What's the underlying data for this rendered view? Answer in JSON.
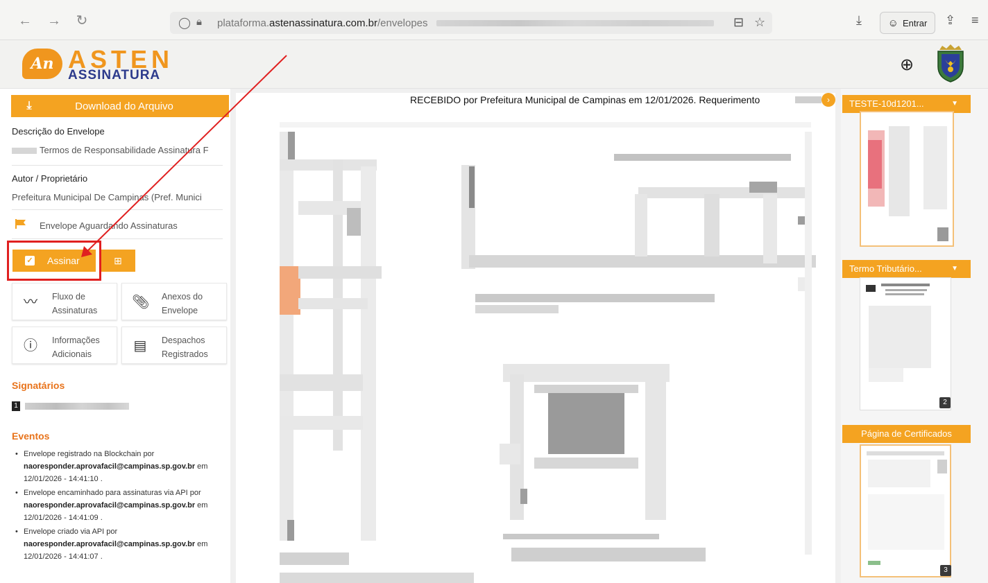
{
  "browser": {
    "url_prefix": "plataforma.",
    "url_domain": "astenassinatura.com.br",
    "url_path": "/envelopes",
    "signin_label": "Entrar"
  },
  "header": {
    "logo_top": "ASTEN",
    "logo_bottom": "ASSINATURA"
  },
  "sidebar": {
    "download_label": "Download do Arquivo",
    "description_label": "Descrição do Envelope",
    "description_value": "Termos de Responsabilidade Assinatura F",
    "author_label": "Autor / Proprietário",
    "author_value": "Prefeitura Municipal De Campinas (Pref. Munici",
    "status": "Envelope  Aguardando Assinaturas",
    "sign_label": "Assinar",
    "tiles": [
      {
        "line1": "Fluxo de",
        "line2": "Assinaturas"
      },
      {
        "line1": "Anexos do",
        "line2": "Envelope"
      },
      {
        "line1": "Informações",
        "line2": "Adicionais"
      },
      {
        "line1": "Despachos",
        "line2": "Registrados"
      }
    ],
    "signatories_title": "Signatários",
    "signatory_number": "1",
    "events_title": "Eventos",
    "events": [
      {
        "text": "Envelope registrado na Blockchain por",
        "email": "naoresponder.aprovafacil@campinas.sp.gov.br",
        "em": "em",
        "date": "12/01/2026 - 14:41:10 ."
      },
      {
        "text": "Envelope encaminhado para assinaturas via API por",
        "email": "naoresponder.aprovafacil@campinas.sp.gov.br",
        "em": "em",
        "date": "12/01/2026 - 14:41:09 ."
      },
      {
        "text": "Envelope criado via API por",
        "email": "naoresponder.aprovafacil@campinas.sp.gov.br",
        "em": "em",
        "date": "12/01/2026 - 14:41:07 ."
      }
    ]
  },
  "viewer": {
    "received_text": "RECEBIDO por Prefeitura Municipal de Campinas em 12/01/2026. Requerimento"
  },
  "thumbnails": [
    {
      "label": "TESTE-10d1201...",
      "page": ""
    },
    {
      "label": "Termo Tributário...",
      "page": "2"
    },
    {
      "label": "Página de Certificados",
      "page": "3"
    }
  ],
  "colors": {
    "accent": "#f4a321",
    "section_title": "#e8731b",
    "highlight": "#e02020"
  }
}
